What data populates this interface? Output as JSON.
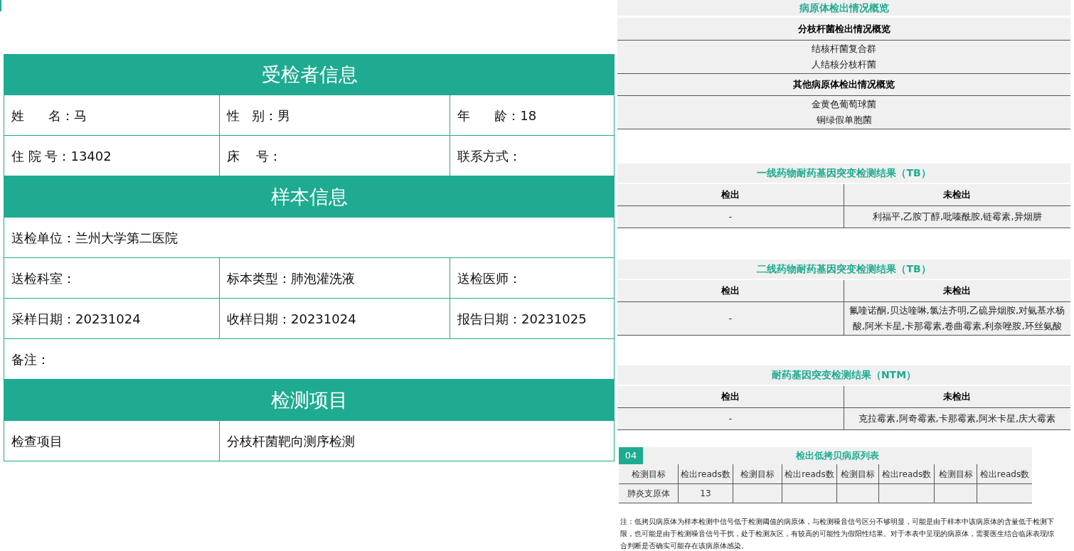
{
  "report_sections": [
    {
      "title": "受检者信息",
      "rows": [
        [
          "姓      名：马",
          "性   别：男",
          "年      龄：18"
        ],
        [
          "住 院 号：13402",
          "床    号：",
          "联系方式："
        ]
      ]
    },
    {
      "title": "样本信息",
      "rows": [
        [
          "送检单位：兰州大学第二医院"
        ],
        [
          "送检科室：",
          "标本类型：肺泡灌洗液",
          "送检医师："
        ],
        [
          "采样日期：20231024",
          "收样日期：20231024",
          "报告日期：20231025"
        ],
        [
          "备注："
        ]
      ]
    },
    {
      "title": "检测项目",
      "rows": [
        [
          "检查项目",
          "分枝杆菌靶向测序检测"
        ]
      ]
    }
  ],
  "overview": {
    "title": "病原体检出情况概览",
    "groups": [
      {
        "heading": "分枝杆菌检出情况概览",
        "items": [
          "结核杆菌复合群",
          "人结核分枝杆菌"
        ]
      },
      {
        "heading": "其他病原体检出情况概览",
        "items": [
          "金黄色葡萄球菌",
          "铜绿假单胞菌"
        ]
      }
    ]
  },
  "resistance_tables": [
    {
      "title": "一线药物耐药基因突变检测结果（TB）",
      "columns": [
        "检出",
        "未检出"
      ],
      "rows": [
        [
          "-",
          "利福平,乙胺丁醇,吡嗪酰胺,链霉素,异烟肼"
        ]
      ]
    },
    {
      "title": "二线药物耐药基因突变检测结果（TB）",
      "columns": [
        "检出",
        "未检出"
      ],
      "rows": [
        [
          "-",
          "氟喹诺酮,贝达喹啉,氯法齐明,乙硫异烟胺,对氨基水杨酸,阿米卡星,卡那霉素,卷曲霉素,利奈唑胺,环丝氨酸"
        ]
      ]
    },
    {
      "title": "耐药基因突变检测结果（NTM）",
      "columns": [
        "检出",
        "未检出"
      ],
      "rows": [
        [
          "-",
          "克拉霉素,阿奇霉素,卡那霉素,阿米卡星,庆大霉素"
        ]
      ]
    }
  ],
  "low_copy": {
    "badge": "04",
    "title": "检出低拷贝病原列表",
    "columns": [
      "检测目标",
      "检出reads数",
      "检测目标",
      "检出reads数",
      "检测目标",
      "检出reads数",
      "检测目标",
      "检出reads数"
    ],
    "rows": [
      [
        "肺炎支原体",
        "13"
      ]
    ]
  },
  "note": "注：低拷贝病原体为样本检测中信号低于检测阈值的病原体，与检测噪音信号区分不够明显，可能是由于样本中该病原体的含量低于检测下限，也可能是由于检测噪音信号干扰，处于检测灰区，有较高的可能性为假阳性结果。对于本表中呈现的病原体，需要医生结合临床表现综合判断是否确实可能存在该病原体感染。"
}
